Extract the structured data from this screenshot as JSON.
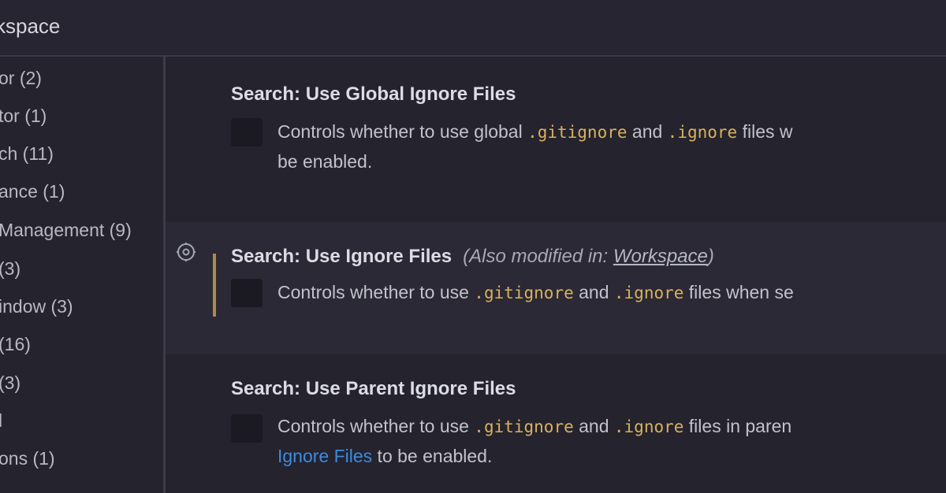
{
  "header": {
    "tab_label": "kspace"
  },
  "sidebar": {
    "items": [
      {
        "label": "or (2)"
      },
      {
        "label": "tor (1)"
      },
      {
        "label": "ch (11)"
      },
      {
        "label": "ance (1)"
      },
      {
        "label": "Management (9)"
      },
      {
        "label": "(3)"
      },
      {
        "label": "indow (3)"
      },
      {
        "label": "(16)"
      },
      {
        "label": "(3)"
      },
      {
        "label": "l"
      },
      {
        "label": "ons (1)"
      }
    ]
  },
  "settings": [
    {
      "category": "Search: ",
      "name": "Use Global Ignore Files",
      "desc_line1_a": "Controls whether to use global ",
      "desc_line1_code1": ".gitignore",
      "desc_line1_b": " and ",
      "desc_line1_code2": ".ignore",
      "desc_line1_c": " files w",
      "desc_line2": "be enabled."
    },
    {
      "category": "Search: ",
      "name": "Use Ignore Files",
      "modified_prefix": "(Also modified in: ",
      "modified_link": "Workspace",
      "modified_suffix": ")",
      "desc_line1_a": "Controls whether to use ",
      "desc_line1_code1": ".gitignore",
      "desc_line1_b": " and ",
      "desc_line1_code2": ".ignore",
      "desc_line1_c": " files when se"
    },
    {
      "category": "Search: ",
      "name": "Use Parent Ignore Files",
      "desc_line1_a": "Controls whether to use ",
      "desc_line1_code1": ".gitignore",
      "desc_line1_b": " and ",
      "desc_line1_code2": ".ignore",
      "desc_line1_c": " files in paren",
      "desc_line2_link": "Ignore Files",
      "desc_line2": " to be enabled."
    }
  ],
  "colors": {
    "background": "#24232e",
    "code": "#d9b15d",
    "link": "#3c8be0",
    "modified_indicator": "#b08a4a"
  }
}
